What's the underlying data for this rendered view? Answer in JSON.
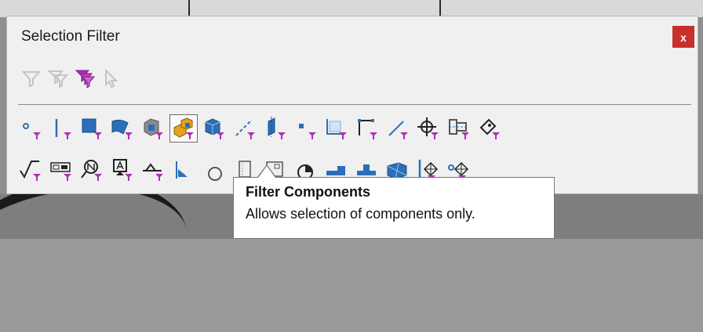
{
  "window": {
    "title": "Selection Filter",
    "close_label": "x"
  },
  "filter_toolbar": [
    "filter-icon",
    "filter-toggle-icon",
    "filter-all-icon",
    "selection-cursor-icon"
  ],
  "row1": [
    {
      "icon": "point-icon"
    },
    {
      "icon": "edge-icon"
    },
    {
      "icon": "face-icon"
    },
    {
      "icon": "surface-body-icon"
    },
    {
      "icon": "solid-body-icon"
    },
    {
      "icon": "components-icon",
      "active": true
    },
    {
      "icon": "solid-body-cube-icon"
    },
    {
      "icon": "axis-icon"
    },
    {
      "icon": "plane-icon"
    },
    {
      "icon": "sketch-point-icon"
    },
    {
      "icon": "sketch-region-icon"
    },
    {
      "icon": "sketch-segment-icon"
    },
    {
      "icon": "sketch-line-icon"
    },
    {
      "icon": "center-mark-icon"
    },
    {
      "icon": "centerline-icon"
    },
    {
      "icon": "dimension-icon"
    }
  ],
  "row2": [
    {
      "icon": "surface-finish-icon"
    },
    {
      "icon": "geometric-tolerance-icon"
    },
    {
      "icon": "notes-icon"
    },
    {
      "icon": "datum-feature-icon"
    },
    {
      "icon": "weld-symbol-icon"
    },
    {
      "icon": "datum-target-icon"
    },
    {
      "icon": "hole-callout-icon"
    },
    {
      "icon": "cosmetic-thread-icon"
    },
    {
      "icon": "blocks-icon"
    },
    {
      "icon": "midpoint-icon"
    },
    {
      "icon": "routing-icon"
    },
    {
      "icon": "connection-icon"
    },
    {
      "icon": "mesh-facet-icon"
    },
    {
      "icon": "mesh-edge-icon"
    },
    {
      "icon": "mesh-vertex-icon"
    }
  ],
  "tooltip": {
    "title": "Filter Components",
    "description": "Allows selection of components only."
  },
  "colors": {
    "accent": "#b02fb6",
    "close_bg": "#c9302c",
    "icon_blue": "#2a6fb8"
  }
}
